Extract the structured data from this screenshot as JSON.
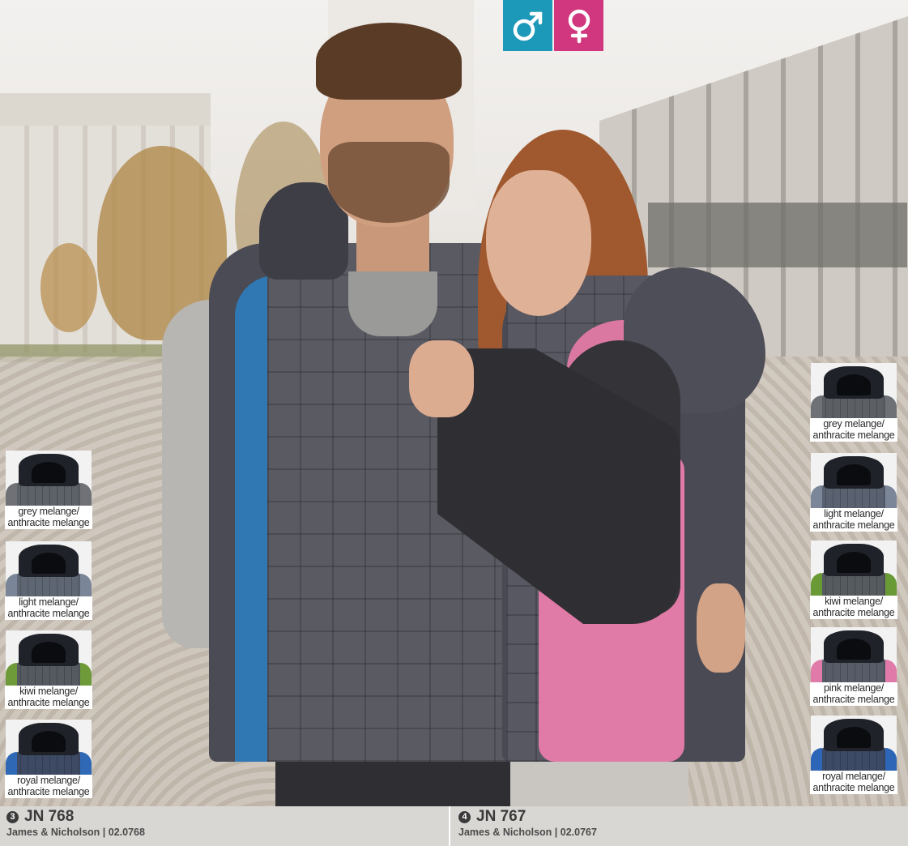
{
  "header": {
    "gender_icons": [
      "male-symbol",
      "female-symbol"
    ]
  },
  "left_swatches": [
    {
      "label": "grey melange/\nanthracite melange",
      "vest": "#5d6168",
      "accent": "#6f7177"
    },
    {
      "label": "light melange/\nanthracite melange",
      "vest": "#5f6673",
      "accent": "#7a8597"
    },
    {
      "label": "kiwi melange/\nanthracite melange",
      "vest": "#555a60",
      "accent": "#6f9a3a"
    },
    {
      "label": "royal melange/\nanthracite melange",
      "vest": "#3e4a64",
      "accent": "#2f68b5"
    }
  ],
  "right_swatches": [
    {
      "label": "grey melange/\nanthracite melange",
      "vest": "#5c6065",
      "accent": "#6e7176"
    },
    {
      "label": "light melange/\nanthracite melange",
      "vest": "#5a6170",
      "accent": "#7b8699"
    },
    {
      "label": "kiwi melange/\nanthracite melange",
      "vest": "#565b60",
      "accent": "#6a9a36"
    },
    {
      "label": "pink melange/\nanthracite melange",
      "vest": "#585c68",
      "accent": "#e07aa8"
    },
    {
      "label": "royal melange/\nanthracite melange",
      "vest": "#3d4a66",
      "accent": "#2d66b6"
    }
  ],
  "products": [
    {
      "number": "3",
      "code": "JN 768",
      "brand": "James & Nicholson | 02.0768"
    },
    {
      "number": "4",
      "code": "JN 767",
      "brand": "James & Nicholson | 02.0767"
    }
  ]
}
